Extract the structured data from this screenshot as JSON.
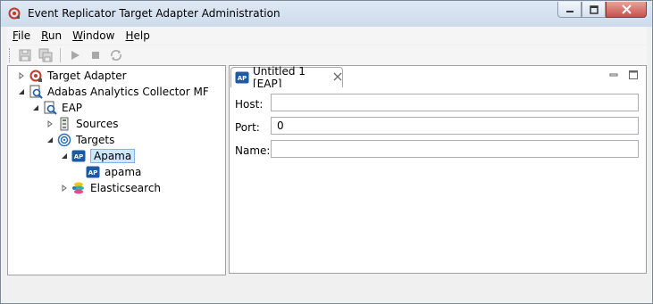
{
  "window": {
    "title": "Event Replicator Target Adapter Administration"
  },
  "menu": [
    {
      "mnemonic": "F",
      "rest": "ile"
    },
    {
      "mnemonic": "R",
      "rest": "un"
    },
    {
      "mnemonic": "W",
      "rest": "indow"
    },
    {
      "mnemonic": "H",
      "rest": "elp"
    }
  ],
  "tree": {
    "target_adapter": "Target Adapter",
    "collector": "Adabas Analytics Collector MF",
    "eap": "EAP",
    "sources": "Sources",
    "targets": "Targets",
    "apama": "Apama",
    "apama_child": "apama",
    "elasticsearch": "Elasticsearch"
  },
  "editor": {
    "tab_title": "Untitled 1 [EAP]",
    "tab_icon_text": "AP",
    "fields": {
      "host_label": "Host:",
      "host_value": "",
      "port_label": "Port:",
      "port_value": "0",
      "name_label": "Name:",
      "name_value": ""
    }
  },
  "icons": {
    "app": "target-adapter-icon",
    "apama_text": "AP"
  },
  "colors": {
    "accent": "#3b6fb6",
    "selection": "#cde8ff",
    "close_button": "#c75050"
  }
}
